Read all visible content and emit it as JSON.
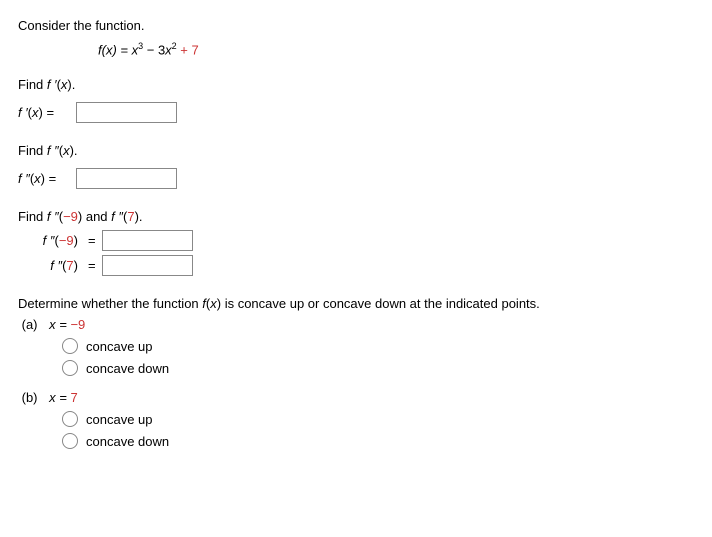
{
  "intro": "Consider the function.",
  "func_lhs": "f(x) = ",
  "func_term1": "x",
  "func_exp1": "3",
  "func_op1": " − ",
  "func_coef2": "3",
  "func_term2": "x",
  "func_exp2": "2",
  "func_op2": " + ",
  "func_const": "7",
  "find1_instruction": "Find f ′(x).",
  "find1_label": "f ′(x) =",
  "find2_instruction": "Find f ″(x).",
  "find2_label": "f ″(x) =",
  "find3_instruction_pre": "Find f ″(",
  "find3_val1": "−9",
  "find3_instruction_mid": ") and f ″(",
  "find3_val2": "7",
  "find3_instruction_post": ").",
  "eval1_label": "f ″(−9)",
  "eval2_label": "f ″(7)",
  "eq_sign": "=",
  "determine_text": "Determine whether the function f(x) is concave up or concave down at the indicated points.",
  "part_a": "(a)",
  "part_a_eq": "x = ",
  "part_a_val": "−9",
  "part_b": "(b)",
  "part_b_eq": "x = ",
  "part_b_val": "7",
  "opt_up": "concave up",
  "opt_down": "concave down"
}
